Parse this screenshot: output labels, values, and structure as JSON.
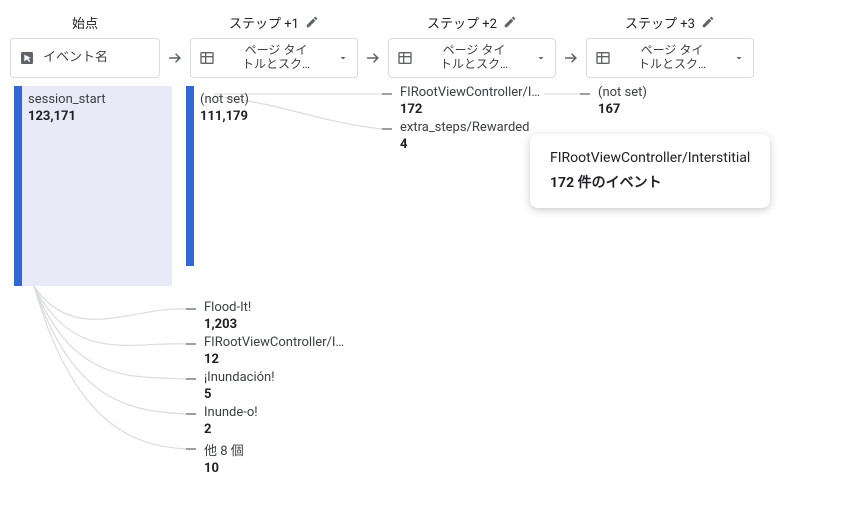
{
  "headers": {
    "start": "始点",
    "step1": "ステップ +1",
    "step2": "ステップ +2",
    "step3": "ステップ +3"
  },
  "selectors": {
    "start_label": "イベント名",
    "page_label_line1": "ページ タイ",
    "page_label_line2": "トルとスク…"
  },
  "col0": {
    "item0": {
      "label": "session_start",
      "value": "123,171"
    }
  },
  "col1": {
    "item0": {
      "label": "(not set)",
      "value": "111,179"
    },
    "item1": {
      "label": "Flood-It!",
      "value": "1,203"
    },
    "item2": {
      "label": "FIRootViewController/I…",
      "value": "12"
    },
    "item3": {
      "label": "¡Inundación!",
      "value": "5"
    },
    "item4": {
      "label": "Inunde-o!",
      "value": "2"
    },
    "more": {
      "label": "他 8 個",
      "value": "10"
    }
  },
  "col2": {
    "item0": {
      "label": "FIRootViewController/I…",
      "value": "172"
    },
    "item1": {
      "label": "extra_steps/Rewarded",
      "value": "4"
    }
  },
  "col3": {
    "item0": {
      "label": "(not set)",
      "value": "167"
    }
  },
  "tooltip": {
    "title": "FIRootViewController/Interstitial",
    "subtitle": "172 件のイベント"
  },
  "chart_data": {
    "type": "other",
    "title": "Sankey / path exploration",
    "series": [
      {
        "name": "始点",
        "nodes": [
          {
            "label": "session_start",
            "value": 123171
          }
        ]
      },
      {
        "name": "ステップ +1",
        "nodes": [
          {
            "label": "(not set)",
            "value": 111179
          },
          {
            "label": "Flood-It!",
            "value": 1203
          },
          {
            "label": "FIRootViewController/I…",
            "value": 12
          },
          {
            "label": "¡Inundación!",
            "value": 5
          },
          {
            "label": "Inunde-o!",
            "value": 2
          },
          {
            "label": "他 8 個",
            "value": 10
          }
        ]
      },
      {
        "name": "ステップ +2",
        "nodes": [
          {
            "label": "FIRootViewController/I…",
            "value": 172
          },
          {
            "label": "extra_steps/Rewarded",
            "value": 4
          }
        ]
      },
      {
        "name": "ステップ +3",
        "nodes": [
          {
            "label": "(not set)",
            "value": 167
          }
        ]
      }
    ]
  }
}
